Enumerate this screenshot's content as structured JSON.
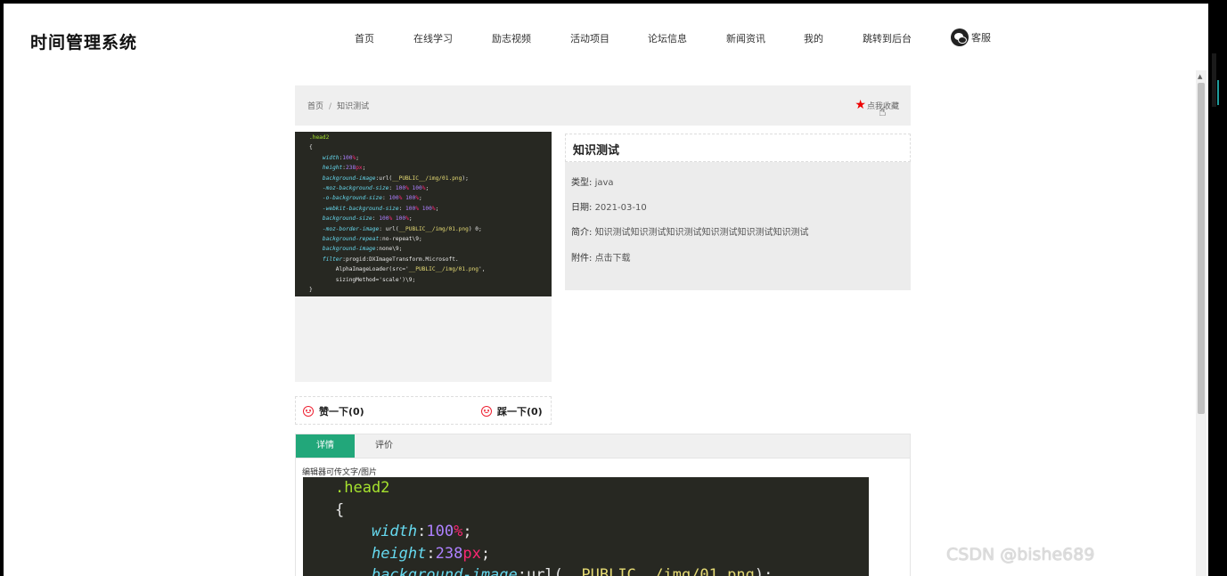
{
  "site": {
    "title": "时间管理系统"
  },
  "nav": {
    "items": [
      {
        "label": "首页"
      },
      {
        "label": "在线学习"
      },
      {
        "label": "励志视频"
      },
      {
        "label": "活动项目"
      },
      {
        "label": "论坛信息"
      },
      {
        "label": "新闻资讯"
      },
      {
        "label": "我的"
      },
      {
        "label": "跳转到后台"
      }
    ],
    "service_label": "客服"
  },
  "breadcrumb": {
    "home": "首页",
    "separator": "/",
    "current": "知识测试"
  },
  "favorite": {
    "label": "点我收藏",
    "icon": "star-icon",
    "color": "#e00000"
  },
  "thumb_code": [
    ".head2",
    "{",
    "    width:100%;",
    "    height:238px;",
    "    background-image:url(__PUBLIC__/img/01.png);",
    "    -moz-background-size: 100% 100%;",
    "    -o-background-size: 100% 100%;",
    "    -webkit-background-size: 100% 100%;",
    "    background-size: 100% 100%;",
    "    -moz-border-image: url(__PUBLIC__/img/01.png) 0;",
    "    background-repeat:no-repeat\\9;",
    "    background-image:none\\9;",
    "    filter:progid:DXImageTransform.Microsoft.",
    "        AlphaImageLoader(src='__PUBLIC__/img/01.png',",
    "        sizingMethod='scale')\\9;",
    "}"
  ],
  "info": {
    "title": "知识测试",
    "type_label": "类型:",
    "type_value": "java",
    "date_label": "日期:",
    "date_value": "2021-03-10",
    "intro_label": "简介:",
    "intro_value": "知识测试知识测试知识测试知识测试知识测试知识测试",
    "attach_label": "附件:",
    "attach_value": "点击下载"
  },
  "votes": {
    "like": "赞一下(0)",
    "dislike": "踩一下(0)"
  },
  "tabs": {
    "active": "详情",
    "second": "评价"
  },
  "detail": {
    "note": "编辑器可传文字/图片",
    "code_lines": [
      ".head2",
      "{",
      "    width:100%;",
      "    height:238px;",
      "    background-image:url(__PUBLIC__/img/01.png);"
    ]
  },
  "watermark": {
    "text": "CSDN @bishe689",
    "small": "CSDN @"
  },
  "colors": {
    "accent_green": "#22a77a",
    "code_bg": "#272822",
    "vote_red": "#e22233"
  }
}
